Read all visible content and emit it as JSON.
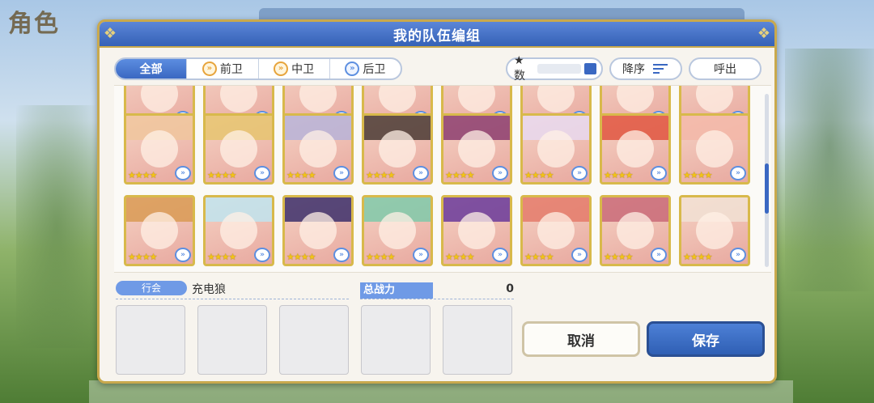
{
  "background": {
    "screen_title": "角色"
  },
  "modal": {
    "title": "我的队伍编组"
  },
  "filters": {
    "tabs": [
      {
        "label": "全部",
        "active": true
      },
      {
        "label": "前卫",
        "active": false
      },
      {
        "label": "中卫",
        "active": false
      },
      {
        "label": "后卫",
        "active": false
      }
    ],
    "stars_label": "★数",
    "sort_label": "降序",
    "callout_label": "呼出"
  },
  "roster": {
    "rows": [
      {
        "cards": [
          {
            "stars": "★★★★"
          },
          {
            "stars": "★★★★"
          },
          {
            "stars": "★★★★"
          },
          {
            "stars": "★★★★"
          },
          {
            "stars": "★★★★"
          },
          {
            "stars": "★★★★"
          },
          {
            "stars": "★★★★"
          },
          {
            "stars": "★★★★"
          }
        ]
      },
      {
        "cards": [
          {
            "stars": "★★★★",
            "hair": "#f0c59c"
          },
          {
            "stars": "★★★★",
            "hair": "#e6c46e"
          },
          {
            "stars": "★★★★",
            "hair": "#b7b3d8"
          },
          {
            "stars": "★★★★",
            "hair": "#4a3a34"
          },
          {
            "stars": "★★★★",
            "hair": "#8c3d6e"
          },
          {
            "stars": "★★★★",
            "hair": "#e7d8ef"
          },
          {
            "stars": "★★★★",
            "hair": "#e0553f"
          },
          {
            "stars": "★★★★",
            "hair": "#f3b7a8"
          }
        ]
      },
      {
        "cards": [
          {
            "stars": "★★★★",
            "hair": "#d99a54"
          },
          {
            "stars": "★★★★",
            "hair": "#bfe4ee"
          },
          {
            "stars": "★★★★",
            "hair": "#3c2f6b"
          },
          {
            "stars": "★★★★",
            "hair": "#7fc9a9"
          },
          {
            "stars": "★★★★",
            "hair": "#6a3a9a"
          },
          {
            "stars": "★★★★",
            "hair": "#e47a6a"
          },
          {
            "stars": "★★★★",
            "hair": "#c96a78"
          },
          {
            "stars": "★★★★",
            "hair": "#f1e0d4"
          }
        ]
      }
    ]
  },
  "team": {
    "guild_label": "行会",
    "guild_name": "充电狼",
    "power_label": "总战力",
    "power_value": "0"
  },
  "actions": {
    "cancel_label": "取消",
    "save_label": "保存"
  },
  "colors": {
    "accent_blue": "#3a68c2",
    "gold_border": "#c9a94d"
  }
}
